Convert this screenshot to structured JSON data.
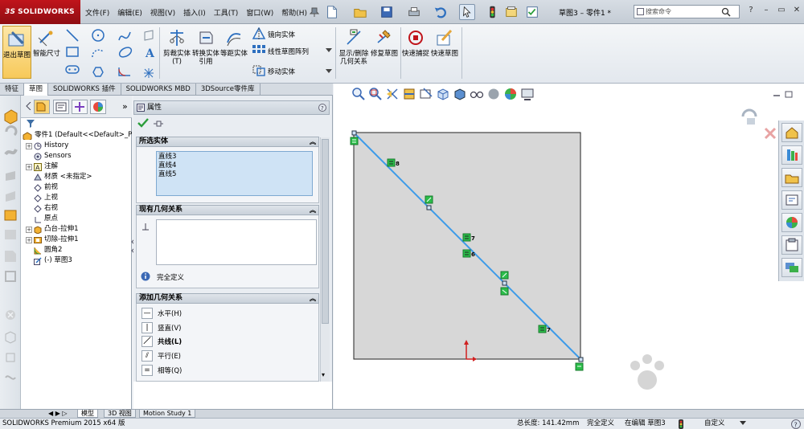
{
  "app": {
    "brand_prefix": "3S",
    "brand_name": "SOLIDWORKS"
  },
  "menu": [
    "文件(F)",
    "编辑(E)",
    "视图(V)",
    "插入(I)",
    "工具(T)",
    "窗口(W)",
    "帮助(H)"
  ],
  "title": "草图3 – 零件1 *",
  "search": {
    "placeholder": "搜索命令"
  },
  "ribbon": {
    "exit_sketch": "退出草图",
    "smart_dim": "智能尺寸",
    "trim": "剪裁实体(T)",
    "convert": "转换实体引用",
    "offset": "等距实体",
    "mirror": "镜向实体",
    "linear_pattern": "线性草图阵列",
    "move": "移动实体",
    "display_rel": "显示/删除几何关系",
    "repair": "修复草图",
    "quick_snap": "快速捕捉",
    "rapid_sketch": "快速草图"
  },
  "tabs": [
    "特征",
    "草图",
    "SOLIDWORKS 插件",
    "SOLIDWORKS MBD",
    "3DSource零件库"
  ],
  "tree": {
    "root": "零件1 (Default<<Default>_P",
    "items": [
      "History",
      "Sensors",
      "注解",
      "材质 <未指定>",
      "前视",
      "上视",
      "右视",
      "原点",
      "凸台-拉伸1",
      "切除-拉伸1",
      "圆角2",
      "(-) 草图3"
    ]
  },
  "pm": {
    "title": "属性",
    "sel_title": "所选实体",
    "selected": [
      "直线3",
      "直线4",
      "直线5"
    ],
    "existing_title": "现有几何关系",
    "status": "完全定义",
    "add_title": "添加几何关系",
    "relations": [
      "水平(H)",
      "竖直(V)",
      "共线(L)",
      "平行(E)",
      "相等(Q)"
    ]
  },
  "sketch": {
    "labels": [
      "8",
      "7",
      "6",
      "7"
    ]
  },
  "bottom_tabs": [
    "模型",
    "3D 视图",
    "Motion Study 1"
  ],
  "status": {
    "product": "SOLIDWORKS Premium 2015 x64 版",
    "length": "总长度: 141.42mm",
    "defined": "完全定义",
    "editing": "在编辑 草图3",
    "custom": "自定义"
  },
  "colors": {
    "brand": "#c0141b",
    "sketch_line": "#3d9be9",
    "relation_green": "#2bbd4a"
  }
}
